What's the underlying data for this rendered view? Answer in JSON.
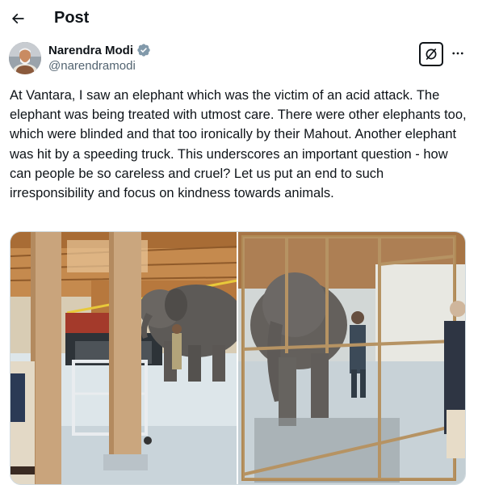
{
  "header": {
    "title": "Post",
    "back_icon": "arrow-left-icon"
  },
  "author": {
    "display_name": "Narendra Modi",
    "handle": "@narendramodi",
    "verified": true,
    "verified_color": "#1d9bf0"
  },
  "actions": {
    "grok_icon": "grok-icon",
    "more_icon": "more-horizontal-icon"
  },
  "post": {
    "text": "At Vantara, I saw an elephant which was the victim of an acid attack. The elephant was being treated with utmost care. There were other elephants too, which were blinded and that too ironically by their Mahout. Another elephant was hit by a speeding truck. This underscores an important question - how can people be so careless and cruel? Let us put an end to such irresponsibility and focus on kindness towards animals."
  },
  "media": {
    "count": 2
  }
}
